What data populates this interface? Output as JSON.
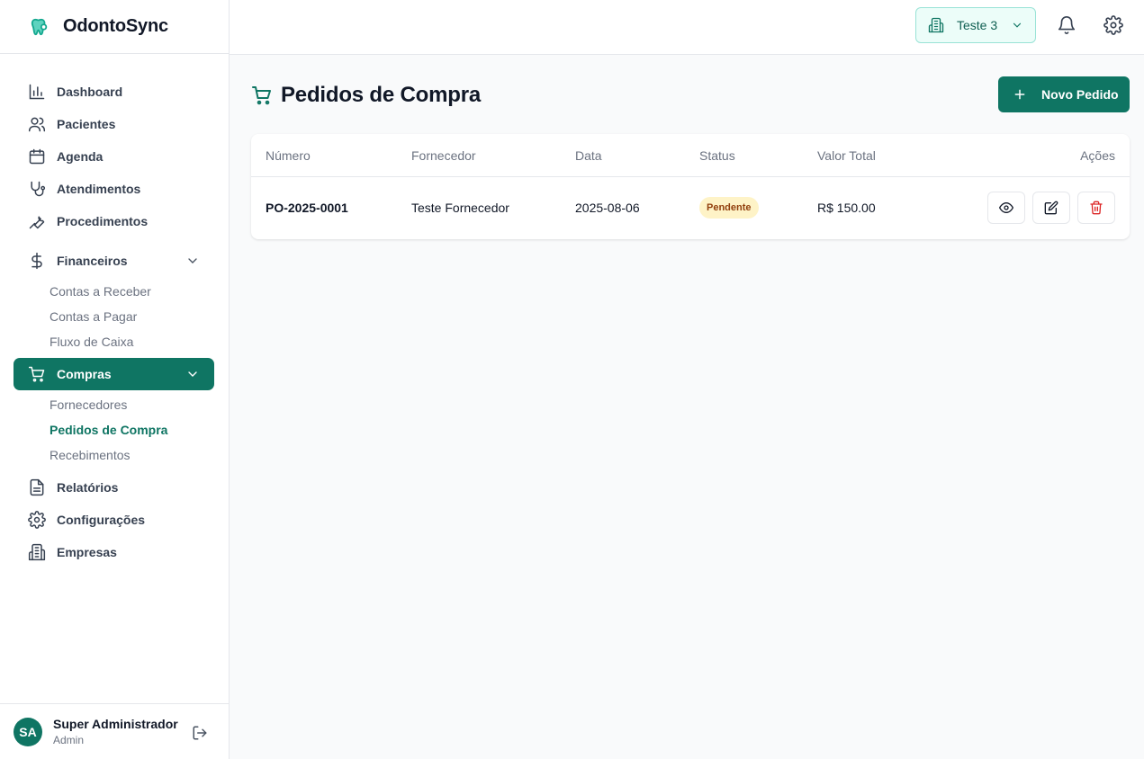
{
  "app": {
    "name": "OdontoSync"
  },
  "sidebar": {
    "items": [
      {
        "label": "Dashboard",
        "icon": "chart-bar-icon"
      },
      {
        "label": "Pacientes",
        "icon": "users-icon"
      },
      {
        "label": "Agenda",
        "icon": "calendar-icon"
      },
      {
        "label": "Atendimentos",
        "icon": "stethoscope-icon"
      },
      {
        "label": "Procedimentos",
        "icon": "wrench-icon"
      }
    ],
    "financeiros": {
      "label": "Financeiros",
      "icon": "dollar-icon",
      "children": [
        "Contas a Receber",
        "Contas a Pagar",
        "Fluxo de Caixa"
      ]
    },
    "compras": {
      "label": "Compras",
      "icon": "cart-icon",
      "children": [
        "Fornecedores",
        "Pedidos de Compra",
        "Recebimentos"
      ],
      "current_child": "Pedidos de Compra"
    },
    "bottom_items": [
      {
        "label": "Relatórios",
        "icon": "document-icon"
      },
      {
        "label": "Configurações",
        "icon": "gear-icon"
      },
      {
        "label": "Empresas",
        "icon": "building-icon"
      }
    ],
    "user": {
      "initials": "SA",
      "name": "Super Administrador",
      "role": "Admin"
    }
  },
  "topbar": {
    "company": "Teste 3"
  },
  "page": {
    "title": "Pedidos de Compra",
    "new_button": "Novo Pedido"
  },
  "table": {
    "headers": {
      "numero": "Número",
      "fornecedor": "Fornecedor",
      "data": "Data",
      "status": "Status",
      "valor": "Valor Total",
      "acoes": "Ações"
    },
    "rows": [
      {
        "numero": "PO-2025-0001",
        "fornecedor": "Teste Fornecedor",
        "data": "2025-08-06",
        "status": "Pendente",
        "valor": "R$ 150.00"
      }
    ]
  },
  "colors": {
    "primary": "#0f7563",
    "pending_bg": "#fef3c7",
    "pending_text": "#92400e",
    "danger": "#dc2626"
  }
}
